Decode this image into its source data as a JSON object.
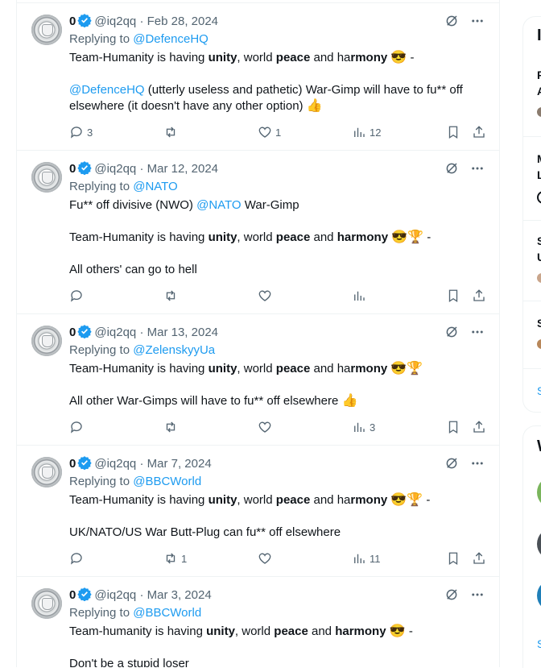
{
  "tweets": [
    {
      "name": "0",
      "handle": "@iq2qq",
      "date": "· Feb 28, 2024",
      "replying_prefix": "Replying to ",
      "replying_to": "@DefenceHQ",
      "line1": {
        "a": "Team-Humanity is having ",
        "b1": "unity",
        "c": ", world ",
        "b2": "peace",
        "d": " and ha",
        "b3": "rmony",
        "e": " ",
        "emoji": "😎",
        "f": " -"
      },
      "line2": {
        "mention": "@DefenceHQ",
        "text": " (utterly useless and pathetic) War-Gimp will have to fu** off"
      },
      "line3": {
        "text": "elsewhere (it doesn't have any other option) ",
        "emoji": "👍"
      },
      "counts": {
        "reply": "3",
        "retweet": "",
        "like": "1",
        "views": "12"
      }
    },
    {
      "name": "0",
      "handle": "@iq2qq",
      "date": "· Mar 12, 2024",
      "replying_prefix": "Replying to ",
      "replying_to": "@NATO",
      "line1": {
        "text": "Fu** off divisive (NWO) ",
        "mention": "@NATO",
        "after": " War-Gimp"
      },
      "line2": {
        "a": "Team-Humanity is having ",
        "b1": "unity",
        "c": ", world ",
        "b2": "peace",
        "d": " and ",
        "b3": "harmony",
        "e": " ",
        "emoji": "😎🏆",
        "f": " -"
      },
      "line3": {
        "text": "All others' can go to hell"
      },
      "counts": {
        "reply": "",
        "retweet": "",
        "like": "",
        "views": ""
      }
    },
    {
      "name": "0",
      "handle": "@iq2qq",
      "date": "· Mar 13, 2024",
      "replying_prefix": "Replying to ",
      "replying_to": "@ZelenskyyUa",
      "line1": {
        "a": "Team-Humanity is having ",
        "b1": "unity",
        "c": ", world ",
        "b2": "peace",
        "d": " and ha",
        "b3": "rmony",
        "e": " ",
        "emoji": "😎🏆",
        "f": ""
      },
      "line2": {
        "text": "All other War-Gimps will have to fu** off elsewhere ",
        "emoji": "👍"
      },
      "counts": {
        "reply": "",
        "retweet": "",
        "like": "",
        "views": "3"
      }
    },
    {
      "name": "0",
      "handle": "@iq2qq",
      "date": "· Mar 7, 2024",
      "replying_prefix": "Replying to ",
      "replying_to": "@BBCWorld",
      "line1": {
        "a": "Team-Humanity is having ",
        "b1": "unity",
        "c": ", world ",
        "b2": "peace",
        "d": " and ha",
        "b3": "rmony",
        "e": " ",
        "emoji": "😎🏆",
        "f": " -"
      },
      "line2": {
        "text": "UK/NATO/US War Butt-Plug can fu** off elsewhere"
      },
      "counts": {
        "reply": "",
        "retweet": "1",
        "like": "",
        "views": "11"
      }
    },
    {
      "name": "0",
      "handle": "@iq2qq",
      "date": "· Mar 3, 2024",
      "replying_prefix": "Replying to ",
      "replying_to": "@BBCWorld",
      "line1": {
        "a": "Team-humanity is having ",
        "b1": "unity",
        "c": ", world ",
        "b2": "peace",
        "d": " and ",
        "b3": "harmony",
        "e": " ",
        "emoji": "😎",
        "f": " -"
      },
      "line2": {
        "text": "Don't be a stupid loser"
      }
    }
  ],
  "sidebar": {
    "card1": {
      "heading": "I",
      "rows": [
        "F",
        "A",
        "M",
        "L",
        "S",
        "U",
        "S"
      ],
      "more": "S"
    },
    "card2": {
      "heading": "W",
      "more": "S"
    }
  },
  "colors": {
    "accent": "#1d9bf0",
    "text": "#0f1419",
    "muted": "#536471",
    "border": "#eff3f4"
  }
}
